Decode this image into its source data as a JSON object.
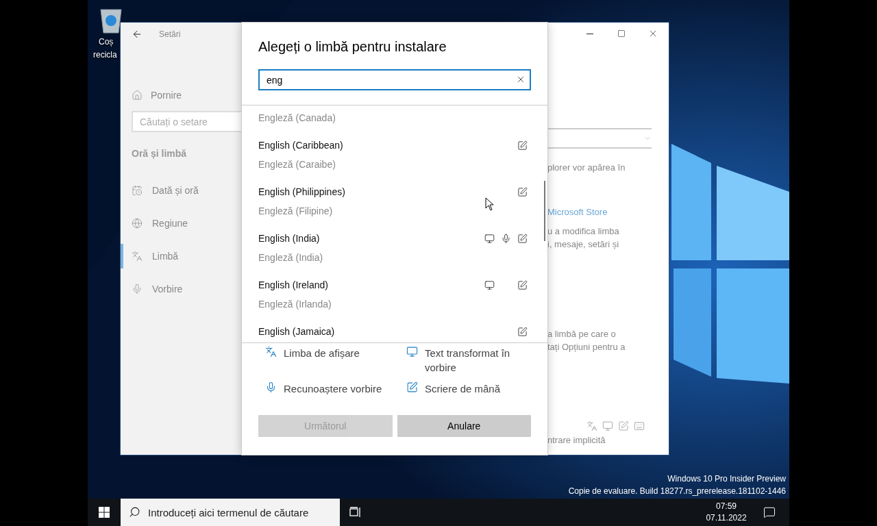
{
  "desktop": {
    "icons": [
      {
        "label_lines": [
          "Coș",
          "recicla"
        ]
      }
    ],
    "watermark": [
      "Windows 10 Pro Insider Preview",
      "Copie de evaluare. Build 18277.rs_prerelease.181102-1446"
    ]
  },
  "settings_window": {
    "title": "Setări",
    "home": "Pornire",
    "search": {
      "placeholder": "Căutați o setare"
    },
    "section": "Oră și limbă",
    "nav_items": [
      {
        "label": "Dată și oră",
        "selected": false
      },
      {
        "label": "Regiune",
        "selected": false
      },
      {
        "label": "Limbă",
        "selected": true
      },
      {
        "label": "Vorbire",
        "selected": false
      }
    ],
    "right_pane": [
      {
        "kind": "dropdown"
      },
      {
        "kind": "text",
        "text": "plorer vor apărea în"
      },
      {
        "kind": "link",
        "text": "Microsoft Store"
      },
      {
        "kind": "text",
        "text": "u a modifica limba"
      },
      {
        "kind": "text",
        "text": "i, mesaje, setări și"
      },
      {
        "kind": "text",
        "text": "a limbă pe care o"
      },
      {
        "kind": "text",
        "text": "tați Opțiuni pentru a"
      },
      {
        "kind": "features"
      },
      {
        "kind": "text",
        "text": "ntrare implicită"
      }
    ]
  },
  "dialog": {
    "title": "Alegeți o limbă pentru instalare",
    "search": {
      "value": "eng"
    },
    "languages": [
      {
        "secondary": "Engleză (Canada)"
      },
      {
        "name": "English (Caribbean)",
        "secondary": "Engleză (Caraibe)",
        "tts": false,
        "speech": false,
        "handwriting": true
      },
      {
        "name": "English (Philippines)",
        "secondary": "Engleză (Filipine)",
        "tts": false,
        "speech": false,
        "handwriting": true
      },
      {
        "name": "English (India)",
        "secondary": "Engleză (India)",
        "tts": true,
        "speech": true,
        "handwriting": true
      },
      {
        "name": "English (Ireland)",
        "secondary": "Engleză (Irlanda)",
        "tts": true,
        "speech": false,
        "handwriting": true
      },
      {
        "name": "English (Jamaica)",
        "tts": false,
        "speech": false,
        "handwriting": true
      }
    ],
    "legend": [
      {
        "kind": "display",
        "label": "Limba de afișare"
      },
      {
        "kind": "tts",
        "label": "Text transformat în vorbire"
      },
      {
        "kind": "speech",
        "label": "Recunoaștere vorbire"
      },
      {
        "kind": "handwriting",
        "label": "Scriere de mână"
      }
    ],
    "buttons": [
      {
        "label": "Următorul",
        "disabled": true
      },
      {
        "label": "Anulare",
        "disabled": false
      }
    ]
  },
  "taskbar": {
    "search": {
      "placeholder": "Introduceți aici termenul de căutare"
    },
    "time": "07:59",
    "date": "07.11.2022"
  }
}
